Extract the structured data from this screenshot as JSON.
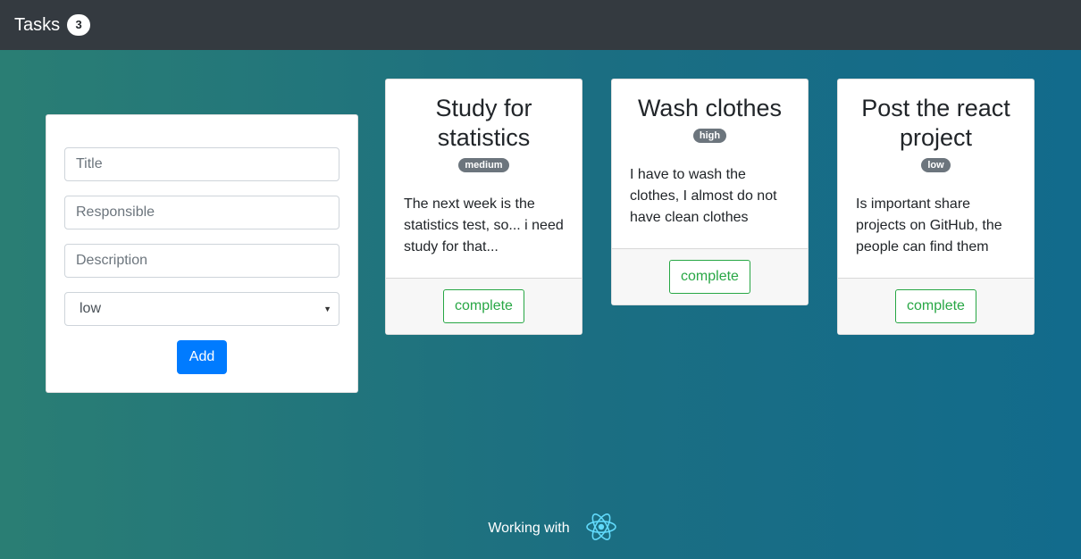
{
  "navbar": {
    "title": "Tasks",
    "task_count": "3"
  },
  "form": {
    "title_placeholder": "Title",
    "responsible_placeholder": "Responsible",
    "description_placeholder": "Description",
    "priority_selected": "low",
    "add_label": "Add"
  },
  "tasks": [
    {
      "title": "Study for statistics",
      "priority": "medium",
      "description": "The next week is the statistics test, so... i need study for that...",
      "action": "complete"
    },
    {
      "title": "Wash clothes",
      "priority": "high",
      "description": "I have to wash the clothes, I almost do not have clean clothes",
      "action": "complete"
    },
    {
      "title": "Post the react project",
      "priority": "low",
      "description": "Is important share projects on GitHub, the people can find them",
      "action": "complete"
    }
  ],
  "footer": {
    "text": "Working with",
    "icon": "react-logo-icon"
  },
  "colors": {
    "navbar": "#343a40",
    "primary": "#007bff",
    "success": "#28a745",
    "badge": "#6c757d",
    "react": "#61dafb"
  }
}
